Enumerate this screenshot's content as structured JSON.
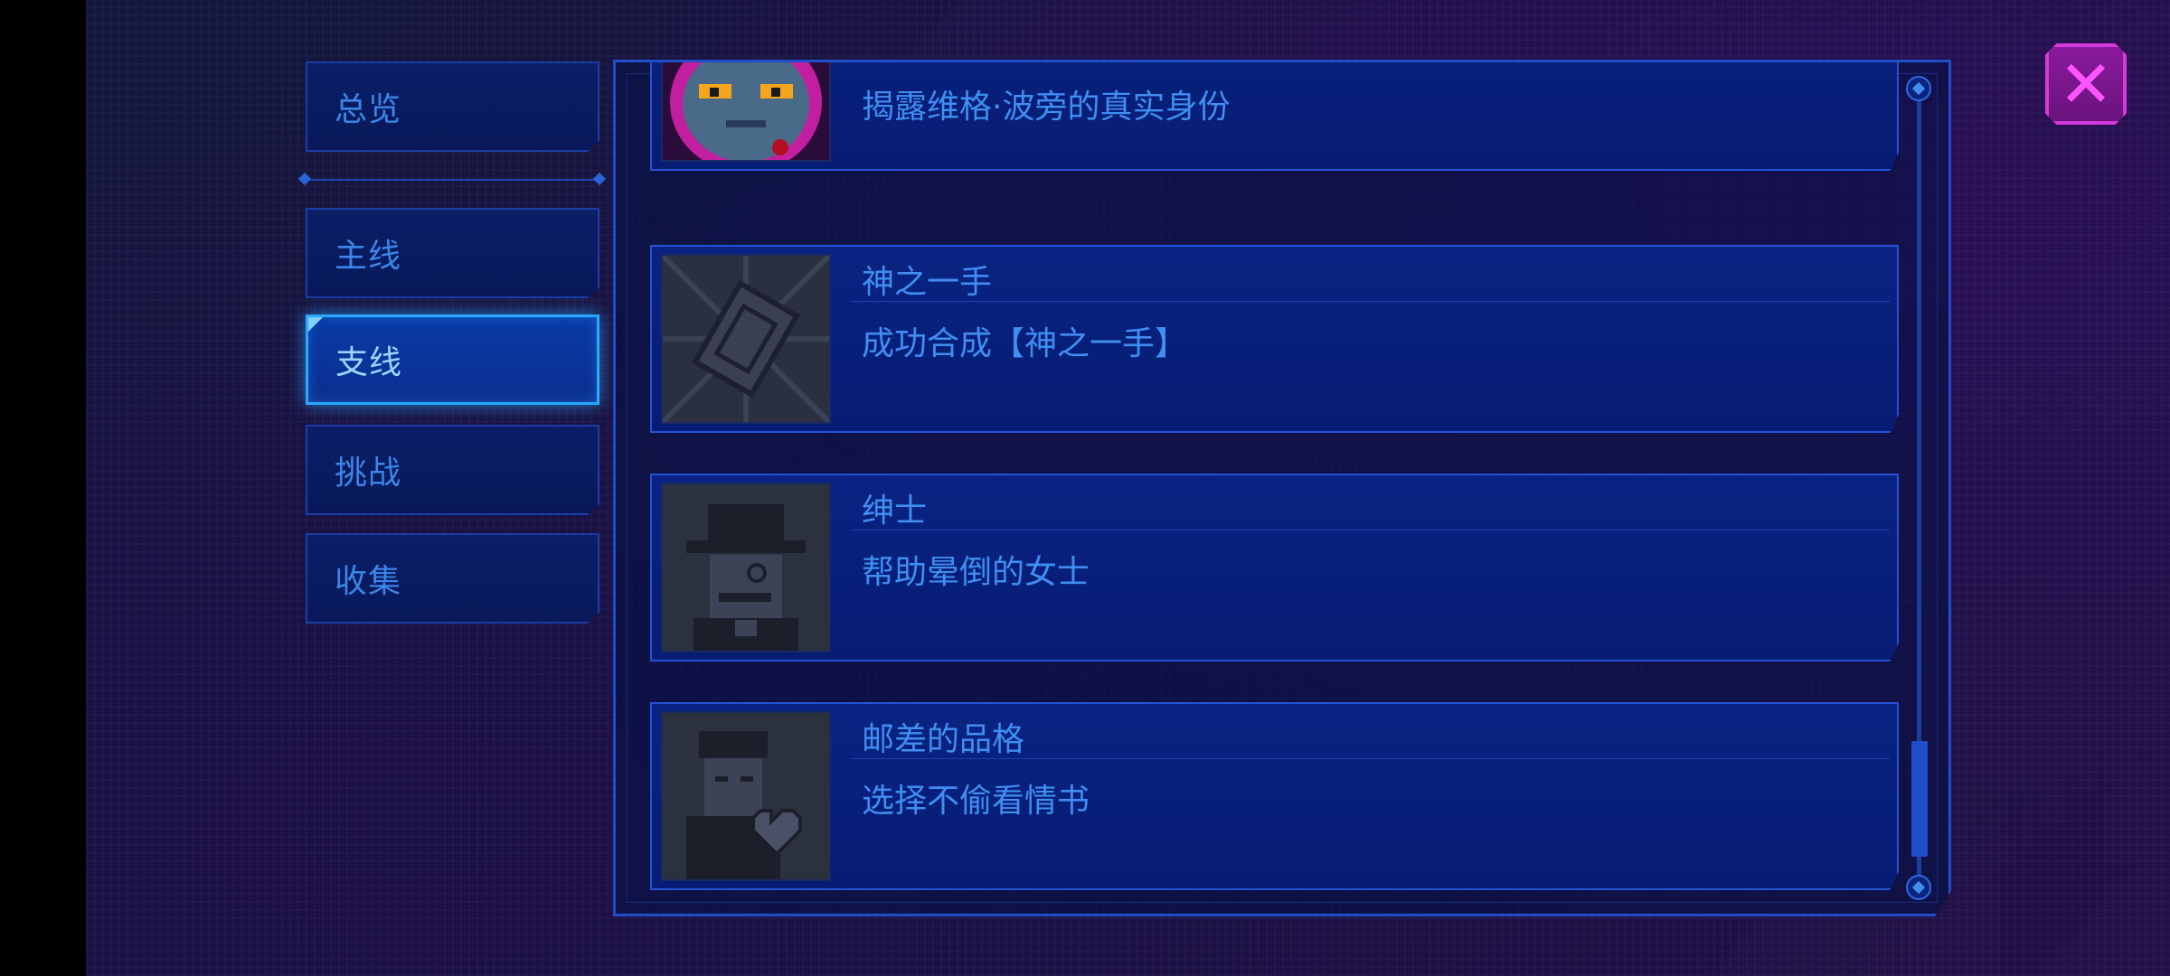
{
  "sidebar": {
    "tabs": [
      {
        "label": "总览",
        "active": false
      },
      {
        "label": "主线",
        "active": false
      },
      {
        "label": "支线",
        "active": true
      },
      {
        "label": "挑战",
        "active": false
      },
      {
        "label": "收集",
        "active": false
      }
    ]
  },
  "achievements": [
    {
      "title": "",
      "description": "揭露维格·波旁的真实身份",
      "icon": "cat-boss-portrait-icon"
    },
    {
      "title": "神之一手",
      "description": "成功合成【神之一手】",
      "icon": "card-relic-icon"
    },
    {
      "title": "绅士",
      "description": "帮助晕倒的女士",
      "icon": "gentleman-portrait-icon"
    },
    {
      "title": "邮差的品格",
      "description": "选择不偷看情书",
      "icon": "postman-heart-icon"
    }
  ],
  "close_button": {
    "icon": "close-icon"
  },
  "colors": {
    "accent": "#2aa7ff",
    "text": "#3f8ef0",
    "close": "#d63ad8"
  }
}
